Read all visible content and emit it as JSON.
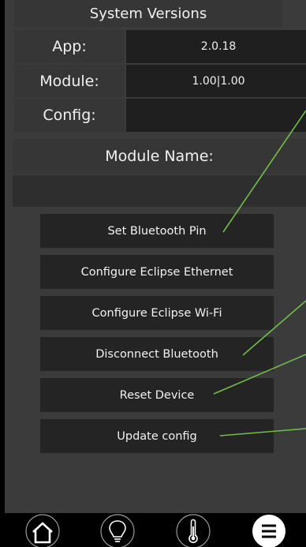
{
  "versions": {
    "title": "System Versions",
    "app_label": "App:",
    "app_value": "2.0.18",
    "module_label": "Module:",
    "module_value": "1.00|1.00",
    "config_label": "Config:",
    "config_value": ""
  },
  "module_name": {
    "label": "Module Name:",
    "value": ""
  },
  "actions": {
    "set_bluetooth_pin": "Set Bluetooth Pin",
    "configure_ethernet": "Configure Eclipse Ethernet",
    "configure_wifi": "Configure Eclipse Wi-Fi",
    "disconnect_bluetooth": "Disconnect Bluetooth",
    "reset_device": "Reset Device",
    "update_config": "Update config"
  },
  "nav": {
    "items": [
      {
        "icon": "home-icon"
      },
      {
        "icon": "lightbulb-icon"
      },
      {
        "icon": "thermometer-icon"
      },
      {
        "icon": "menu-icon"
      }
    ],
    "active_index": 3
  },
  "colors": {
    "panel_bg": "#3b3b3b",
    "cell_dark": "#1f1f1f",
    "button_bg": "#242424",
    "annotation_line": "#6fbf4a",
    "nav_bg": "#000000"
  }
}
